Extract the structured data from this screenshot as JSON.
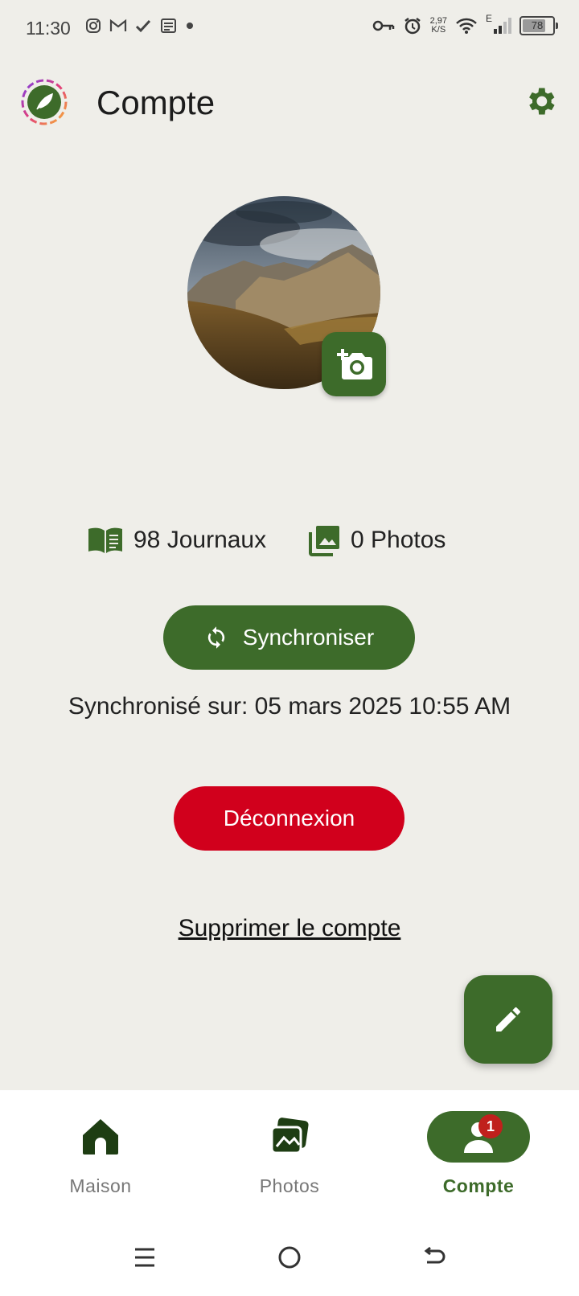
{
  "status_bar": {
    "time": "11:30",
    "speed_value": "2,97",
    "speed_unit": "K/S",
    "network_type": "E",
    "battery": "78",
    "battery_level": 0.78
  },
  "header": {
    "title": "Compte"
  },
  "stats": {
    "journals": "98 Journaux",
    "photos": "0 Photos"
  },
  "sync": {
    "button_label": "Synchroniser",
    "last_sync": "Synchronisé sur: 05 mars 2025 10:55 AM"
  },
  "logout_label": "Déconnexion",
  "delete_account_label": "Supprimer le compte",
  "bottom_nav": {
    "items": [
      {
        "label": "Maison",
        "icon": "home-icon"
      },
      {
        "label": "Photos",
        "icon": "photos-icon"
      },
      {
        "label": "Compte",
        "icon": "account-icon",
        "badge": "1",
        "active": true
      }
    ]
  },
  "colors": {
    "accent": "#3d6b2a",
    "danger": "#d1001c",
    "background": "#efeee9"
  }
}
